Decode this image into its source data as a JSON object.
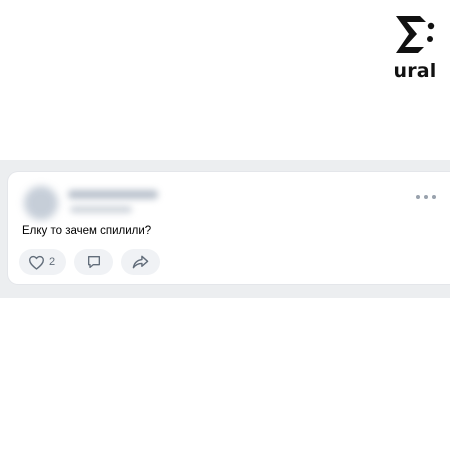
{
  "logo": {
    "word": "ural",
    "icon": "sigma-logo-icon"
  },
  "post": {
    "text": "Елку то зачем спилили?",
    "likes_count": "2",
    "author_blurred": true
  },
  "icons": {
    "more": "more-horizontal-icon",
    "like": "heart-icon",
    "comment": "comment-icon",
    "share": "share-icon"
  },
  "colors": {
    "feed_background": "#eceef0",
    "card_background": "#ffffff",
    "action_background": "#f0f2f5",
    "icon_color": "#626d7a"
  }
}
